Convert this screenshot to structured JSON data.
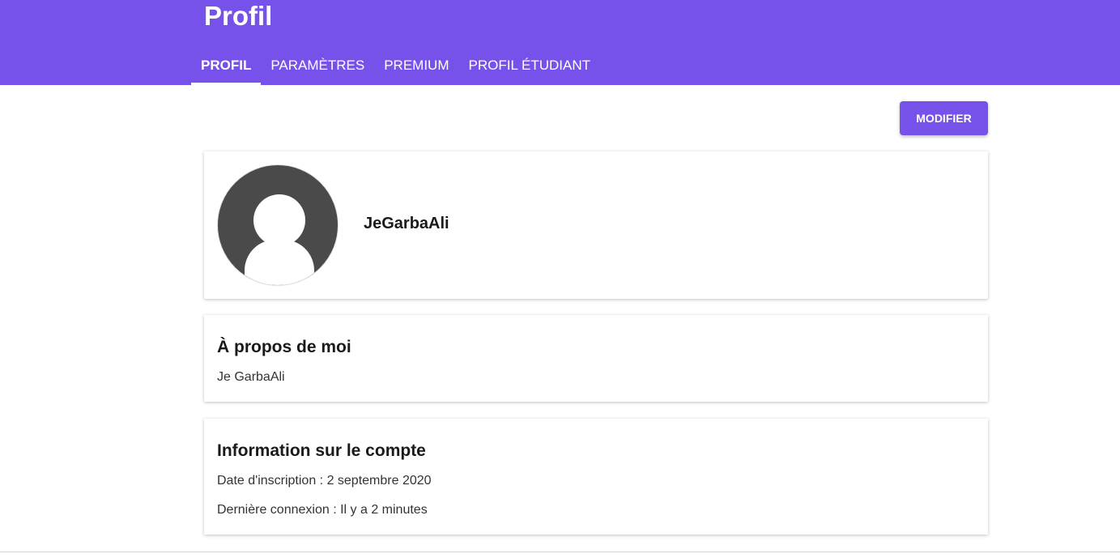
{
  "header": {
    "title": "Profil",
    "tabs": [
      {
        "label": "PROFIL",
        "active": true
      },
      {
        "label": "PARAMÈTRES",
        "active": false
      },
      {
        "label": "PREMIUM",
        "active": false
      },
      {
        "label": "PROFIL ÉTUDIANT",
        "active": false
      }
    ]
  },
  "toolbar": {
    "edit_label": "MODIFIER"
  },
  "profile": {
    "username": "JeGarbaAli",
    "avatar_icon": "default-user-avatar-icon"
  },
  "about": {
    "title": "À propos de moi",
    "text": "Je GarbaAli"
  },
  "account": {
    "title": "Information sur le compte",
    "signup": "Date d'inscription : 2 septembre 2020",
    "last_login": "Dernière connexion : Il y a 2 minutes"
  },
  "colors": {
    "brand": "#7652eb",
    "avatar_bg": "#4a4a4a"
  }
}
